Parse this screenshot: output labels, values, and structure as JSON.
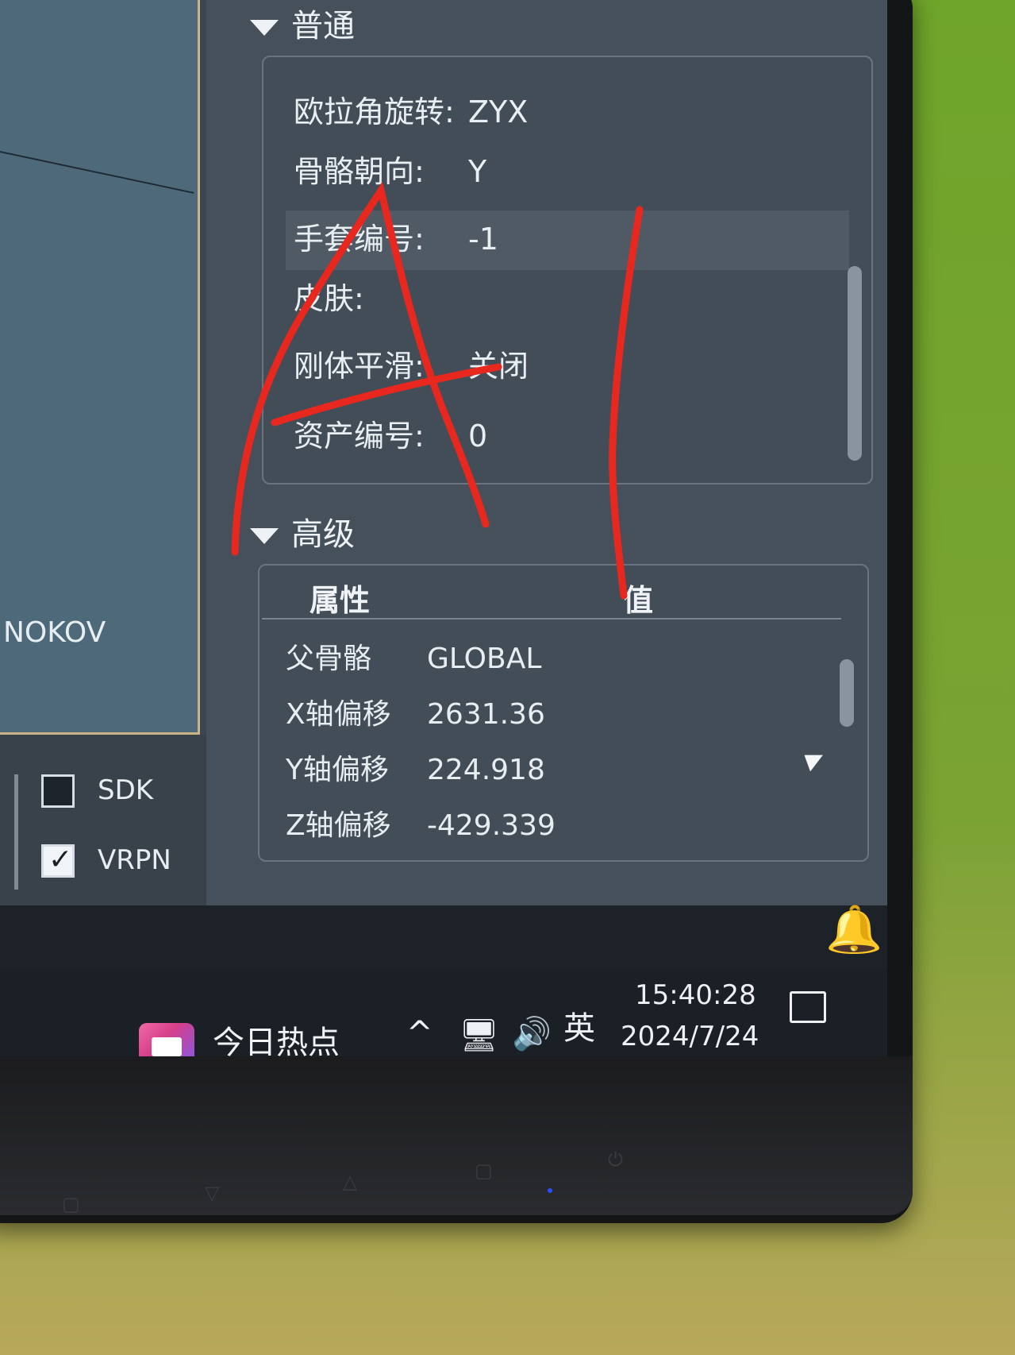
{
  "viewport": {
    "watermark": "NOKOV"
  },
  "protocols": [
    {
      "label": "SDK",
      "checked": false
    },
    {
      "label": "VRPN",
      "checked": true
    }
  ],
  "general": {
    "title": "普通",
    "props": [
      {
        "key": "欧拉角旋转:",
        "value": "ZYX"
      },
      {
        "key": "骨骼朝向:",
        "value": "Y"
      },
      {
        "key": "手套编号:",
        "value": "-1"
      },
      {
        "key": "皮肤:",
        "value": ""
      },
      {
        "key": "刚体平滑:",
        "value": "关闭"
      },
      {
        "key": "资产编号:",
        "value": "0"
      }
    ]
  },
  "advanced": {
    "title": "高级",
    "columns": {
      "property": "属性",
      "value": "值"
    },
    "rows": [
      {
        "key": "父骨骼",
        "value": "GLOBAL"
      },
      {
        "key": "X轴偏移",
        "value": "2631.36"
      },
      {
        "key": "Y轴偏移",
        "value": "224.918"
      },
      {
        "key": "Z轴偏移",
        "value": "-429.339"
      }
    ]
  },
  "taskbar": {
    "news_label": "今日热点",
    "ime": "英",
    "time": "15:40:28",
    "date": "2024/7/24"
  },
  "colors": {
    "panel_bg": "#46505a",
    "taskbar_bg": "#1b2026",
    "annotation_red": "#e8281e"
  }
}
